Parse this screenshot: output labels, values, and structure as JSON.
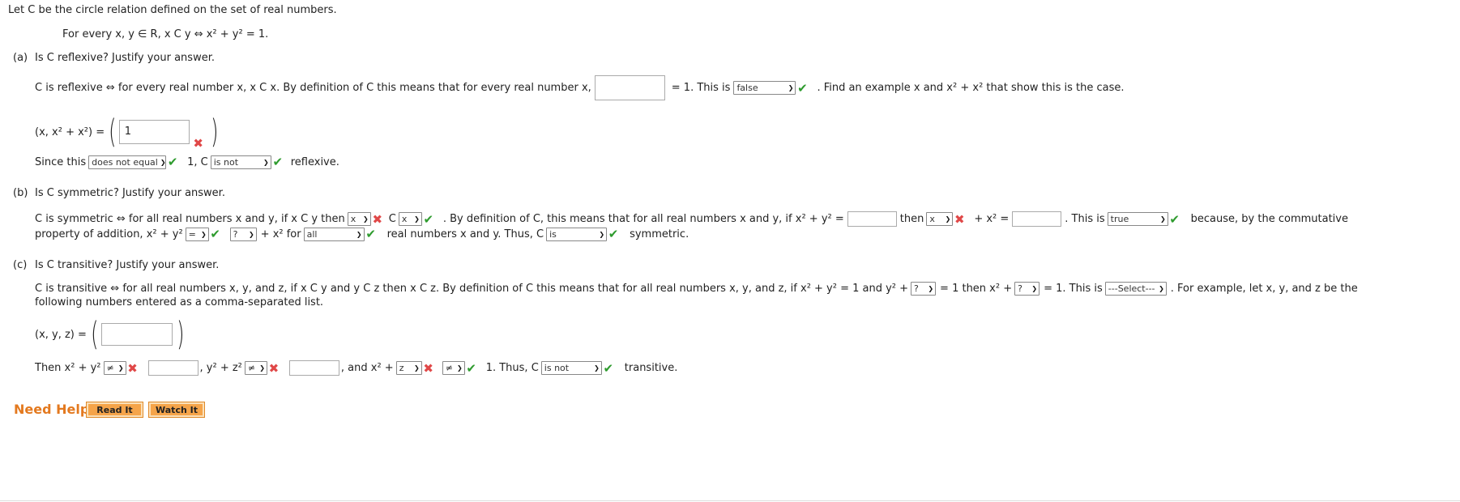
{
  "intro": "Let C be the circle relation defined on the set of real numbers.",
  "definition": "For every x, y ∈ R, x C y ⇔ x² + y² = 1.",
  "a": {
    "label": "(a)",
    "question": "Is C reflexive? Justify your answer.",
    "line1": "C is reflexive ⇔ for every real number x, x C x. By definition of C this means that for every real number x,",
    "eq1": "= 1. This is",
    "sel1": "false",
    "line1_tail": ". Find an example x and x² + x² that show this is the case.",
    "tuple_label": "(x, x² + x²) =",
    "tuple_value": "1",
    "since": "Since this",
    "sel2": "does not equal",
    "one_c": "1, C",
    "sel3": "is not",
    "reflexive": "reflexive."
  },
  "b": {
    "label": "(b)",
    "question": "Is C symmetric? Justify your answer.",
    "line1a": "C is symmetric ⇔ for all real numbers x and y, if x C y then",
    "sel_x1": "x",
    "c_label": "C",
    "sel_x2": "x",
    "line1b": ". By definition of C, this means that for all real numbers x and y, if x² + y² =",
    "then": "then",
    "sel_x3": "x",
    "plus_x2": "+ x² =",
    "this_is": ". This is",
    "sel_true": "true",
    "because": "because, by the commutative",
    "line2a": "property of addition, x² + y²",
    "sel_eq": "=",
    "sel_q": "?",
    "plus_x2_for": "+ x² for",
    "sel_all": "all",
    "line2b": "real numbers x and y. Thus, C",
    "sel_is": "is",
    "symmetric": "symmetric."
  },
  "c": {
    "label": "(c)",
    "question": "Is C transitive? Justify your answer.",
    "line1a": "C is transitive ⇔ for all real numbers x, y, and z, if x C y and y C z then x C z. By definition of C this means that for all real numbers x, y, and z, if x² + y² = 1 and y² +",
    "sel_q1": "?",
    "line1b": "= 1 then x² +",
    "sel_q2": "?",
    "line1c": "= 1. This is",
    "sel_select": "---Select---",
    "line1d": ". For example, let x, y, and z be the",
    "line2": "following numbers entered as a comma-separated list.",
    "tuple_label": "(x, y, z) =",
    "then": "Then x² + y²",
    "sel_ne1": "≠",
    "comma_y2z2": ", y² + z²",
    "sel_ne2": "≠",
    "and_x2": ", and x² +",
    "sel_z": "z",
    "sel_ne3": "≠",
    "one_thus": "1. Thus, C",
    "sel_isnot": "is not",
    "transitive": "transitive."
  },
  "help": {
    "label": "Need Help?",
    "read": "Read It",
    "watch": "Watch It"
  }
}
